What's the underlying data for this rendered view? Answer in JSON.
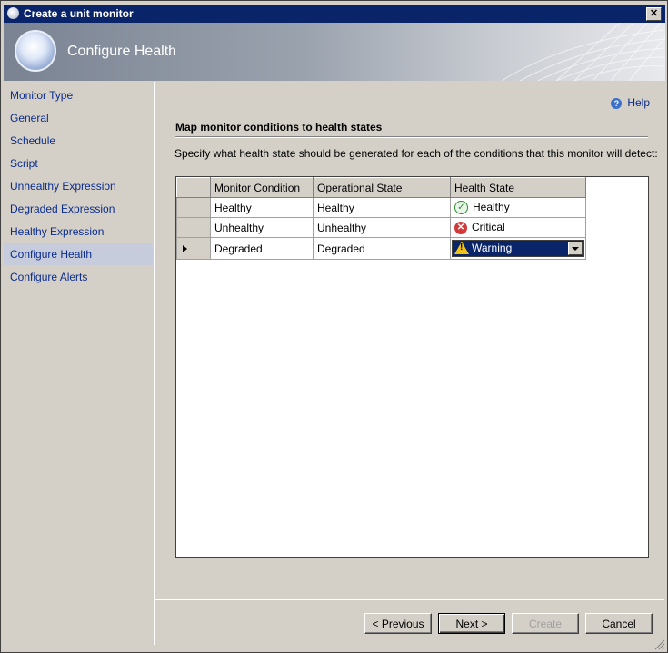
{
  "window": {
    "title": "Create a unit monitor",
    "close_label": "✕"
  },
  "banner": {
    "title": "Configure Health"
  },
  "sidebar": {
    "items": [
      {
        "label": "Monitor Type"
      },
      {
        "label": "General"
      },
      {
        "label": "Schedule"
      },
      {
        "label": "Script"
      },
      {
        "label": "Unhealthy Expression"
      },
      {
        "label": "Degraded Expression"
      },
      {
        "label": "Healthy Expression"
      },
      {
        "label": "Configure Health",
        "selected": true
      },
      {
        "label": "Configure Alerts"
      }
    ]
  },
  "content": {
    "help_label": "Help",
    "section_title": "Map monitor conditions to health states",
    "instruction": "Specify what health state should be generated for each of the conditions that this monitor will detect:",
    "grid": {
      "columns": [
        "Monitor Condition",
        "Operational State",
        "Health State"
      ],
      "rows": [
        {
          "condition": "Healthy",
          "operational": "Healthy",
          "health": "Healthy",
          "icon": "check-icon"
        },
        {
          "condition": "Unhealthy",
          "operational": "Unhealthy",
          "health": "Critical",
          "icon": "error-icon"
        },
        {
          "condition": "Degraded",
          "operational": "Degraded",
          "health": "Warning",
          "icon": "warning-icon"
        }
      ]
    }
  },
  "footer": {
    "previous_label": "< Previous",
    "next_label": "Next >",
    "create_label": "Create",
    "cancel_label": "Cancel"
  },
  "colors": {
    "titlebar": "#0a246a",
    "link": "#0b2c8c",
    "selected_nav": "#c6ccdb",
    "warning": "#f2c314",
    "critical": "#d23a3a",
    "ok": "#2e8b2e"
  }
}
